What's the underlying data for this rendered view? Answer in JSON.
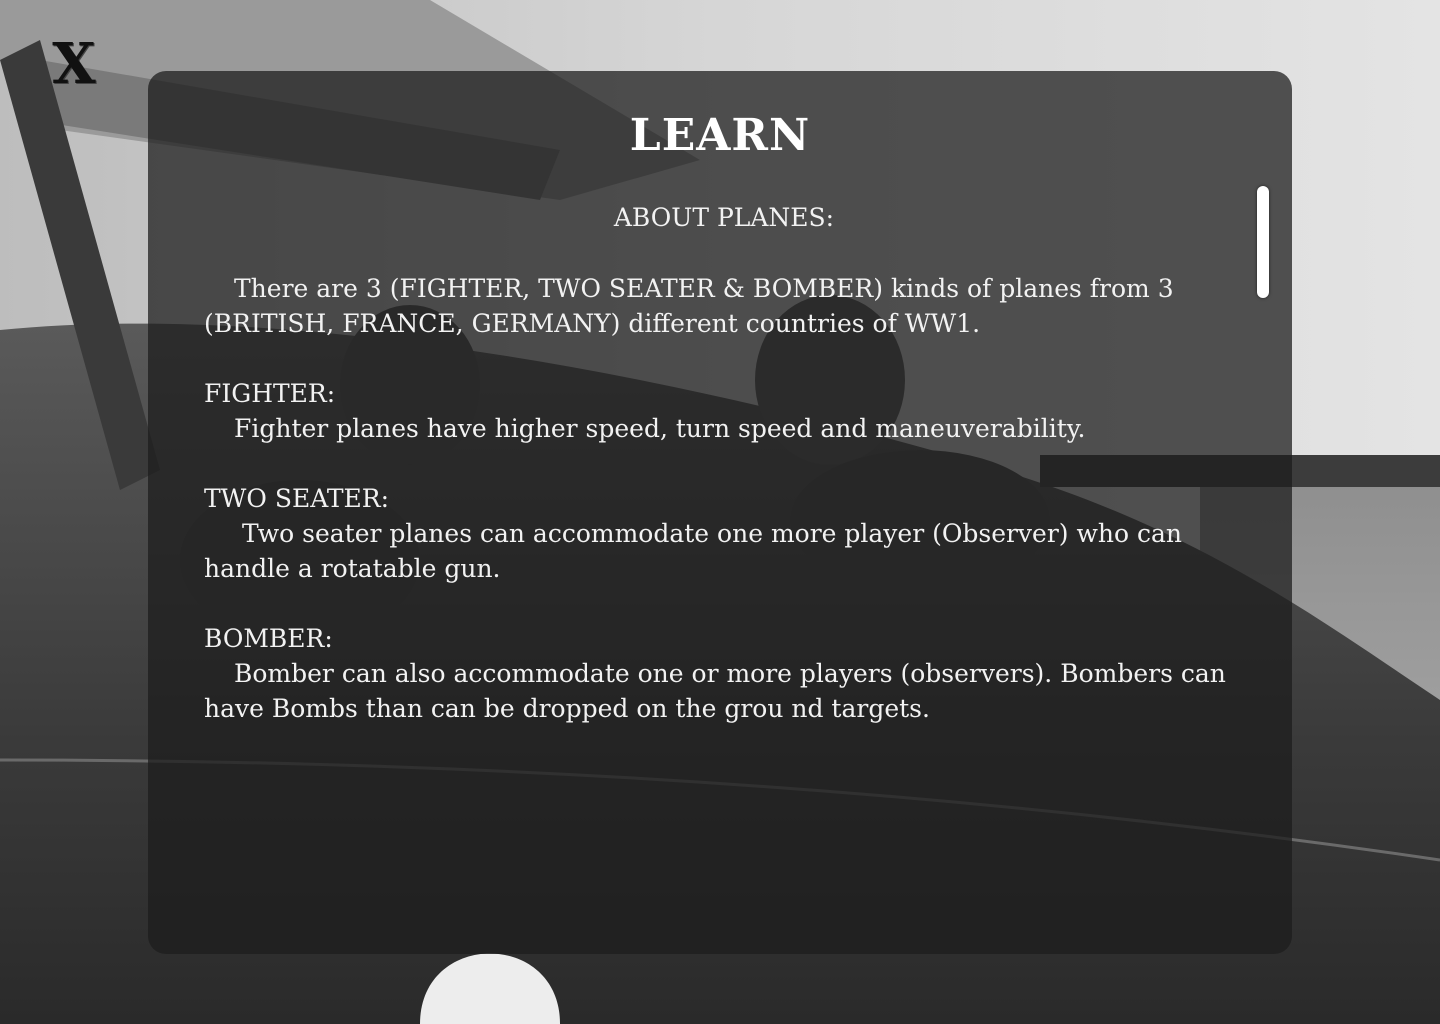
{
  "window": {
    "close_label": "X"
  },
  "learn": {
    "title": "LEARN",
    "about_heading": "ABOUT PLANES:",
    "intro": "There are 3 (FIGHTER, TWO SEATER & BOMBER) kinds of planes from 3 (BRITISH, FRANCE, GERMANY) different countries of WW1.",
    "sections": [
      {
        "label": "FIGHTER:",
        "text": "Fighter planes have higher speed, turn speed and maneuverability."
      },
      {
        "label": "TWO SEATER:",
        "text": " Two seater planes can accommodate one more player (Observer) who can handle a rotatable gun."
      },
      {
        "label": "BOMBER:",
        "text": "Bomber can also accommodate one or more players (observers). Bombers can have Bombs than can be dropped on the grou nd targets."
      }
    ]
  },
  "colors": {
    "panel_bg": "#1c1c1c",
    "text": "#f2f2f2",
    "scrollbar": "#ffffff"
  },
  "icons": {
    "close": "close-icon"
  }
}
